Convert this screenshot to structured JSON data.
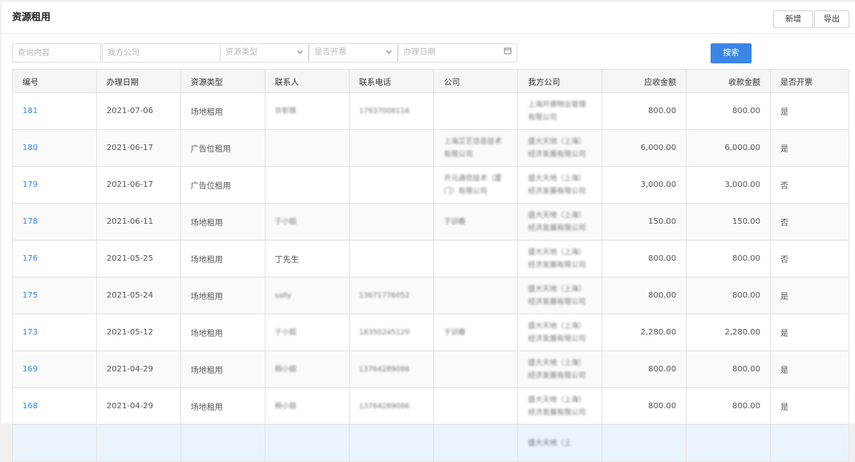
{
  "header": {
    "title": "资源租用",
    "add_label": "新增",
    "export_label": "导出"
  },
  "filters": {
    "query_placeholder": "查询内容",
    "our_company_placeholder": "我方公司",
    "resource_type_placeholder": "资源类型",
    "invoiced_placeholder": "是否开票",
    "date_placeholder": "办理日期",
    "search_label": "搜索"
  },
  "icons": {
    "dropdown": "chevron-down-icon",
    "calendar": "calendar-icon"
  },
  "colors": {
    "accent": "#3a85e6"
  },
  "table": {
    "columns": [
      "编号",
      "办理日期",
      "资源类型",
      "联系人",
      "联系电话",
      "公司",
      "我方公司",
      "应收金额",
      "收款金额",
      "是否开票"
    ],
    "rows": [
      {
        "id": "181",
        "date": "2021-07-06",
        "type": "场地租用",
        "contact": "许彰铁",
        "phone": "17937008116",
        "company": "",
        "our_company": "上海开德物业管理有限公司",
        "receivable": "800.00",
        "received": "800.00",
        "invoiced": "是"
      },
      {
        "id": "180",
        "date": "2021-06-17",
        "type": "广告位租用",
        "contact": "",
        "phone": "",
        "company": "上海艾艺信息技术有限公司",
        "our_company": "盛大天地（上海）经济发展有限公司",
        "receivable": "6,000.00",
        "received": "6,000.00",
        "invoiced": "是"
      },
      {
        "id": "179",
        "date": "2021-06-17",
        "type": "广告位租用",
        "contact": "",
        "phone": "",
        "company": "开元通信技术（厦门）有限公司",
        "our_company": "盛大天地（上海）经济发展有限公司",
        "receivable": "3,000.00",
        "received": "3,000.00",
        "invoiced": "否"
      },
      {
        "id": "178",
        "date": "2021-06-11",
        "type": "场地租用",
        "contact": "于小姐",
        "phone": "",
        "company": "于训春",
        "our_company": "盛大天地（上海）经济发展有限公司",
        "receivable": "150.00",
        "received": "150.00",
        "invoiced": "否"
      },
      {
        "id": "176",
        "date": "2021-05-25",
        "type": "场地租用",
        "contact": "丁先生",
        "phone": "",
        "company": "",
        "our_company": "盛大天地（上海）经济发展有限公司",
        "receivable": "800.00",
        "received": "800.00",
        "invoiced": "否"
      },
      {
        "id": "175",
        "date": "2021-05-24",
        "type": "场地租用",
        "contact": "sally",
        "phone": "13671776052",
        "company": "",
        "our_company": "盛大天地（上海）经济发展有限公司",
        "receivable": "800.00",
        "received": "800.00",
        "invoiced": "是"
      },
      {
        "id": "173",
        "date": "2021-05-12",
        "type": "场地租用",
        "contact": "于小姐",
        "phone": "18350245129",
        "company": "于训春",
        "our_company": "盛大天地（上海）经济发展有限公司",
        "receivable": "2,280.00",
        "received": "2,280.00",
        "invoiced": "是"
      },
      {
        "id": "169",
        "date": "2021-04-29",
        "type": "场地租用",
        "contact": "杨小姐",
        "phone": "13764289086",
        "company": "",
        "our_company": "盛大天地（上海）经济发展有限公司",
        "receivable": "800.00",
        "received": "800.00",
        "invoiced": "是"
      },
      {
        "id": "168",
        "date": "2021-04-29",
        "type": "场地租用",
        "contact": "杨小姐",
        "phone": "13764289086",
        "company": "",
        "our_company": "盛大天地（上海）经济发展有限公司",
        "receivable": "800.00",
        "received": "800.00",
        "invoiced": "是"
      },
      {
        "id": "",
        "date": "",
        "type": "",
        "contact": "",
        "phone": "",
        "company": "",
        "our_company": "盛大天地（上",
        "receivable": "",
        "received": "",
        "invoiced": ""
      }
    ]
  }
}
